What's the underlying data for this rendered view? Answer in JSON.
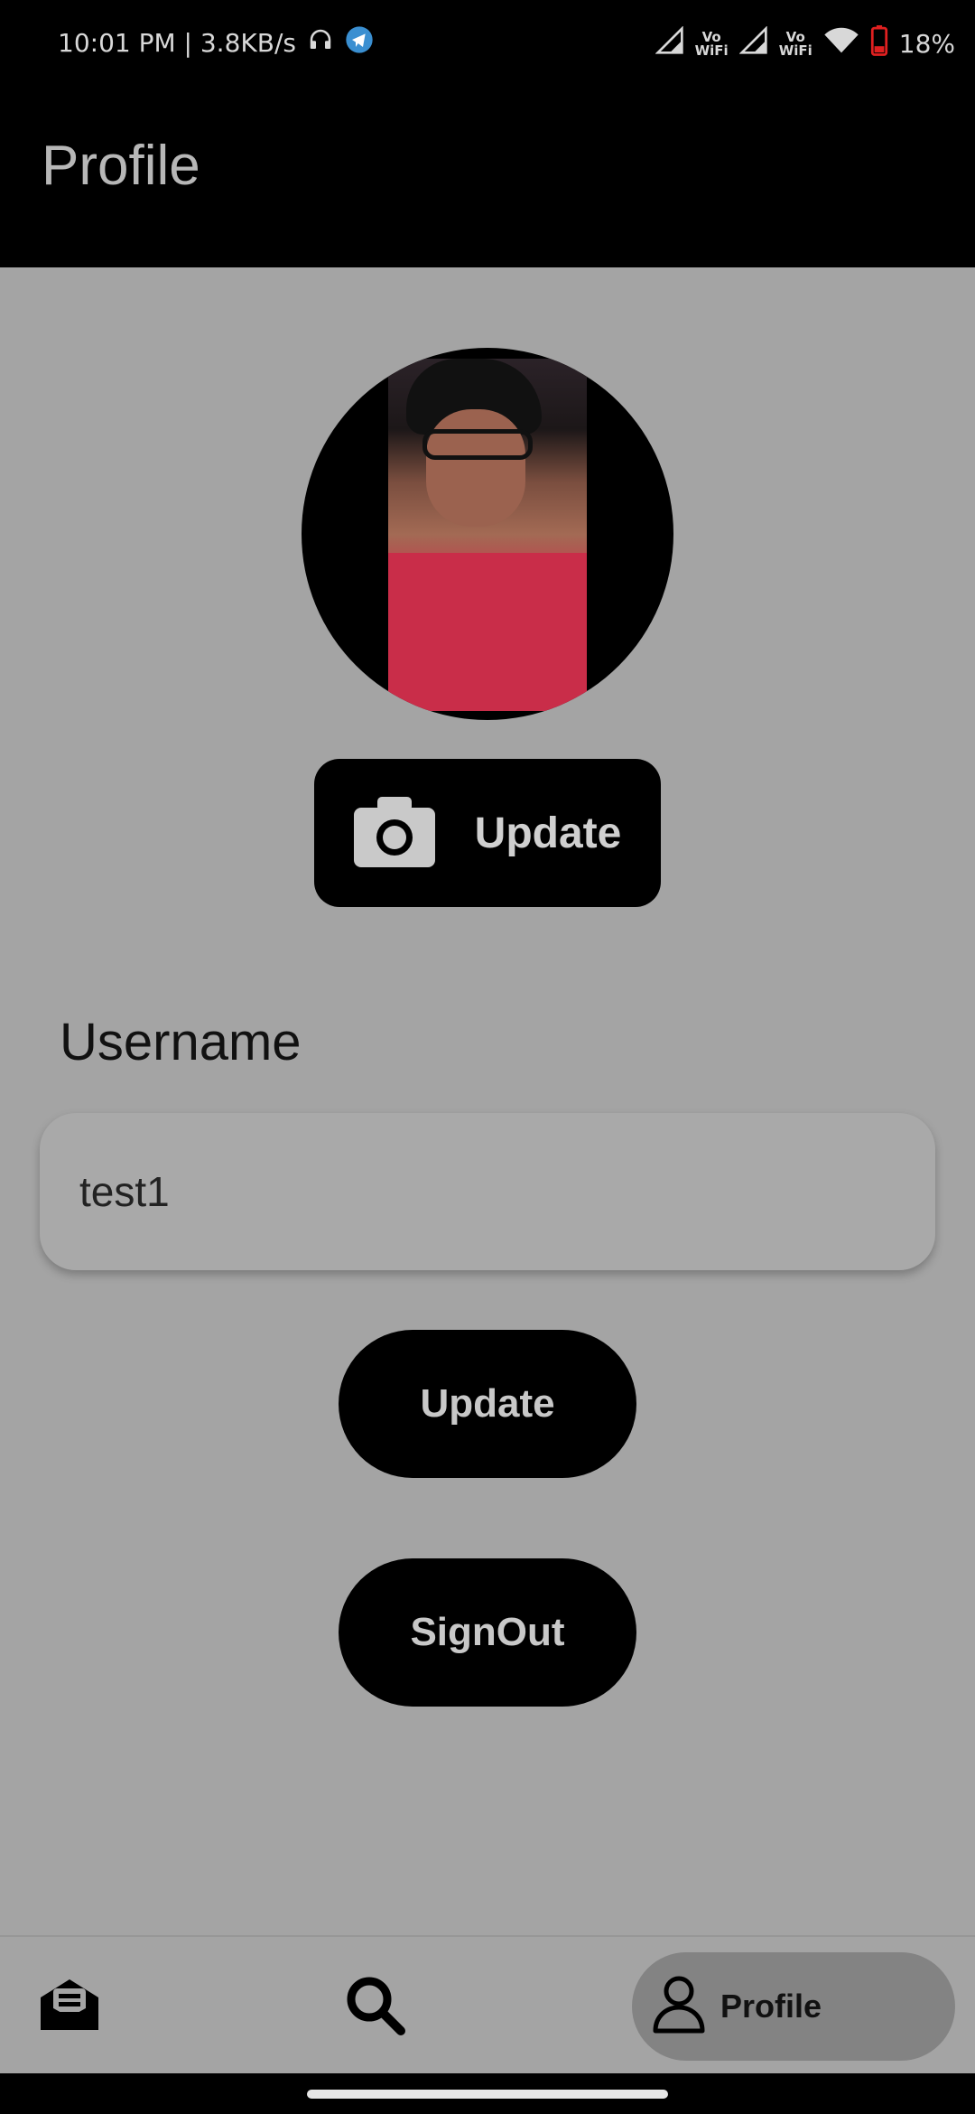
{
  "status_bar": {
    "time_speed": "10:01 PM | 3.8KB/s",
    "network_1": "Vo\nWiFi",
    "network_2": "Vo\nWiFi",
    "battery": "18%"
  },
  "app_bar": {
    "title": "Profile"
  },
  "profile": {
    "update_photo_label": "Update",
    "username_label": "Username",
    "username_value": "test1",
    "update_button": "Update",
    "signout_button": "SignOut"
  },
  "bottom_nav": {
    "items": [
      {
        "icon": "inbox-icon"
      },
      {
        "icon": "search-icon"
      },
      {
        "icon": "person-icon",
        "label": "Profile",
        "active": true
      }
    ]
  },
  "colors": {
    "background": "#a4a4a4",
    "bar": "#000000",
    "button": "#000000",
    "active_nav": "#838383"
  }
}
